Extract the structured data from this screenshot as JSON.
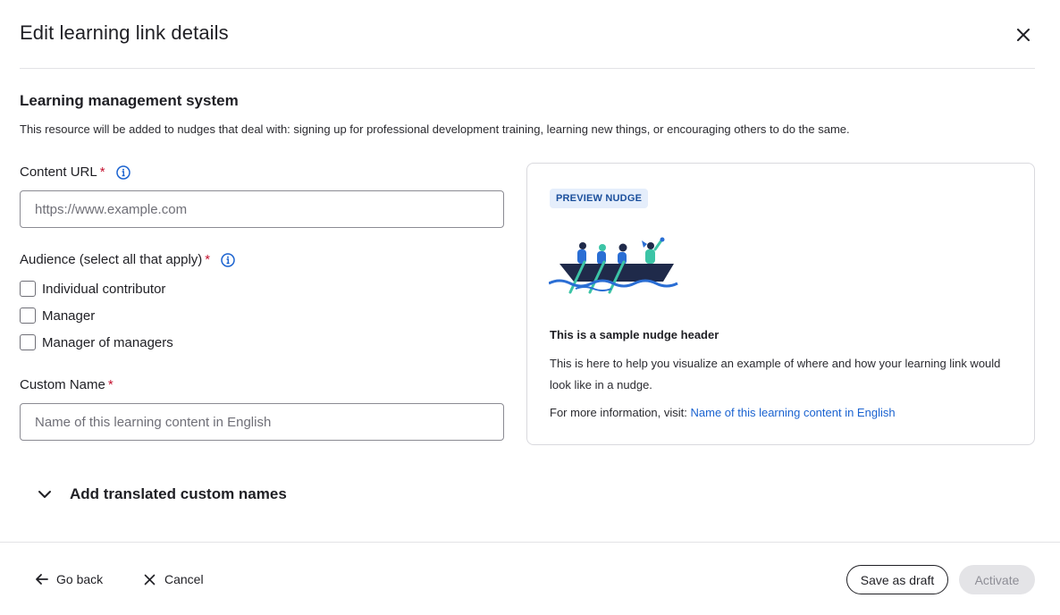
{
  "dialog": {
    "title": "Edit learning link details"
  },
  "section": {
    "title": "Learning management system",
    "description": "This resource will be added to nudges that deal with: signing up for professional development training, learning new things, or encouraging others to do the same."
  },
  "content_url": {
    "label": "Content URL",
    "required_mark": "*",
    "placeholder": "https://www.example.com",
    "value": ""
  },
  "audience": {
    "label": "Audience (select all that apply)",
    "required_mark": "*",
    "options": [
      {
        "label": "Individual contributor",
        "checked": false
      },
      {
        "label": "Manager",
        "checked": false
      },
      {
        "label": "Manager of managers",
        "checked": false
      }
    ]
  },
  "custom_name": {
    "label": "Custom Name",
    "required_mark": "*",
    "placeholder": "Name of this learning content in English",
    "value": ""
  },
  "preview": {
    "badge": "PREVIEW NUDGE",
    "header": "This is a sample nudge header",
    "body": "This is here to help you visualize an example of where and how your learning link would look like in a nudge.",
    "more_prefix": "For more information, visit:",
    "link_text": "Name of this learning content in English",
    "illustration_icon": "rowing-boat-illustration"
  },
  "expander": {
    "label": "Add translated custom names",
    "icon": "chevron-down-icon"
  },
  "footer": {
    "go_back": "Go back",
    "cancel": "Cancel",
    "save_draft": "Save as draft",
    "activate": "Activate"
  },
  "colors": {
    "required": "#c4122f",
    "info_icon": "#1b63d0",
    "link": "#1b63d0",
    "badge_bg": "#e5eefb",
    "badge_text": "#1b4f9c",
    "boat": "#1f2a4a",
    "teal": "#3cc4a6",
    "water": "#2a6ed4"
  }
}
